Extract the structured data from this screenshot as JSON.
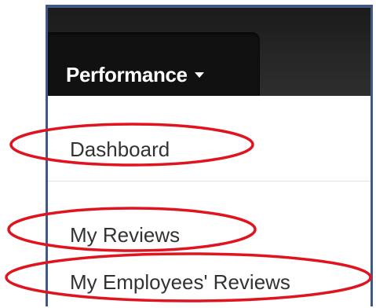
{
  "navbar": {
    "menu_label": "Performance",
    "caret_icon": "caret-down-icon"
  },
  "dropdown": {
    "items": [
      {
        "label": "Dashboard"
      },
      {
        "label": "My Reviews"
      },
      {
        "label": "My Employees' Reviews"
      }
    ]
  },
  "colors": {
    "navbar_bg": "#262626",
    "tab_bg": "#111111",
    "frame_border": "#3e5a84",
    "annotation": "#e0141e",
    "menu_text": "#333333"
  }
}
